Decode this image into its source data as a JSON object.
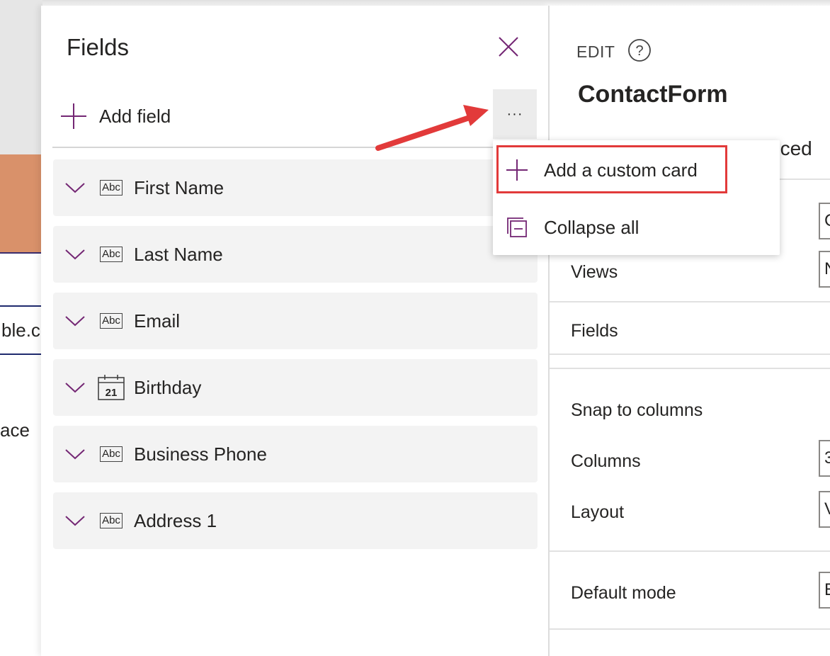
{
  "fields_pane": {
    "title": "Fields",
    "add_field_label": "Add field",
    "more_label": "···",
    "fields": [
      {
        "label": "First Name",
        "type_icon": "Abc"
      },
      {
        "label": "Last Name",
        "type_icon": "Abc"
      },
      {
        "label": "Email",
        "type_icon": "Abc"
      },
      {
        "label": "Birthday",
        "type_icon": "21"
      },
      {
        "label": "Business Phone",
        "type_icon": "Abc"
      },
      {
        "label": "Address 1",
        "type_icon": "Abc"
      }
    ]
  },
  "menu": {
    "add_custom_card": "Add a custom card",
    "collapse_all": "Collapse all"
  },
  "properties": {
    "edit_label": "EDIT",
    "control_name": "ContactForm",
    "tab_advanced_partial": "nced",
    "views": "Views",
    "fields": "Fields",
    "snap_to_columns": "Snap to columns",
    "columns": "Columns",
    "layout": "Layout",
    "default_mode": "Default mode",
    "box_values": {
      "data_source": "C",
      "views": "N",
      "columns": "3",
      "layout": "V",
      "default_mode": "E"
    }
  },
  "canvas": {
    "input_partial": "ble.co",
    "text_partial": "ace"
  },
  "colors": {
    "accent": "#742774",
    "highlight_box": "#e23a3a",
    "arrow": "#e23a3a",
    "row_bg": "#f3f3f3"
  }
}
